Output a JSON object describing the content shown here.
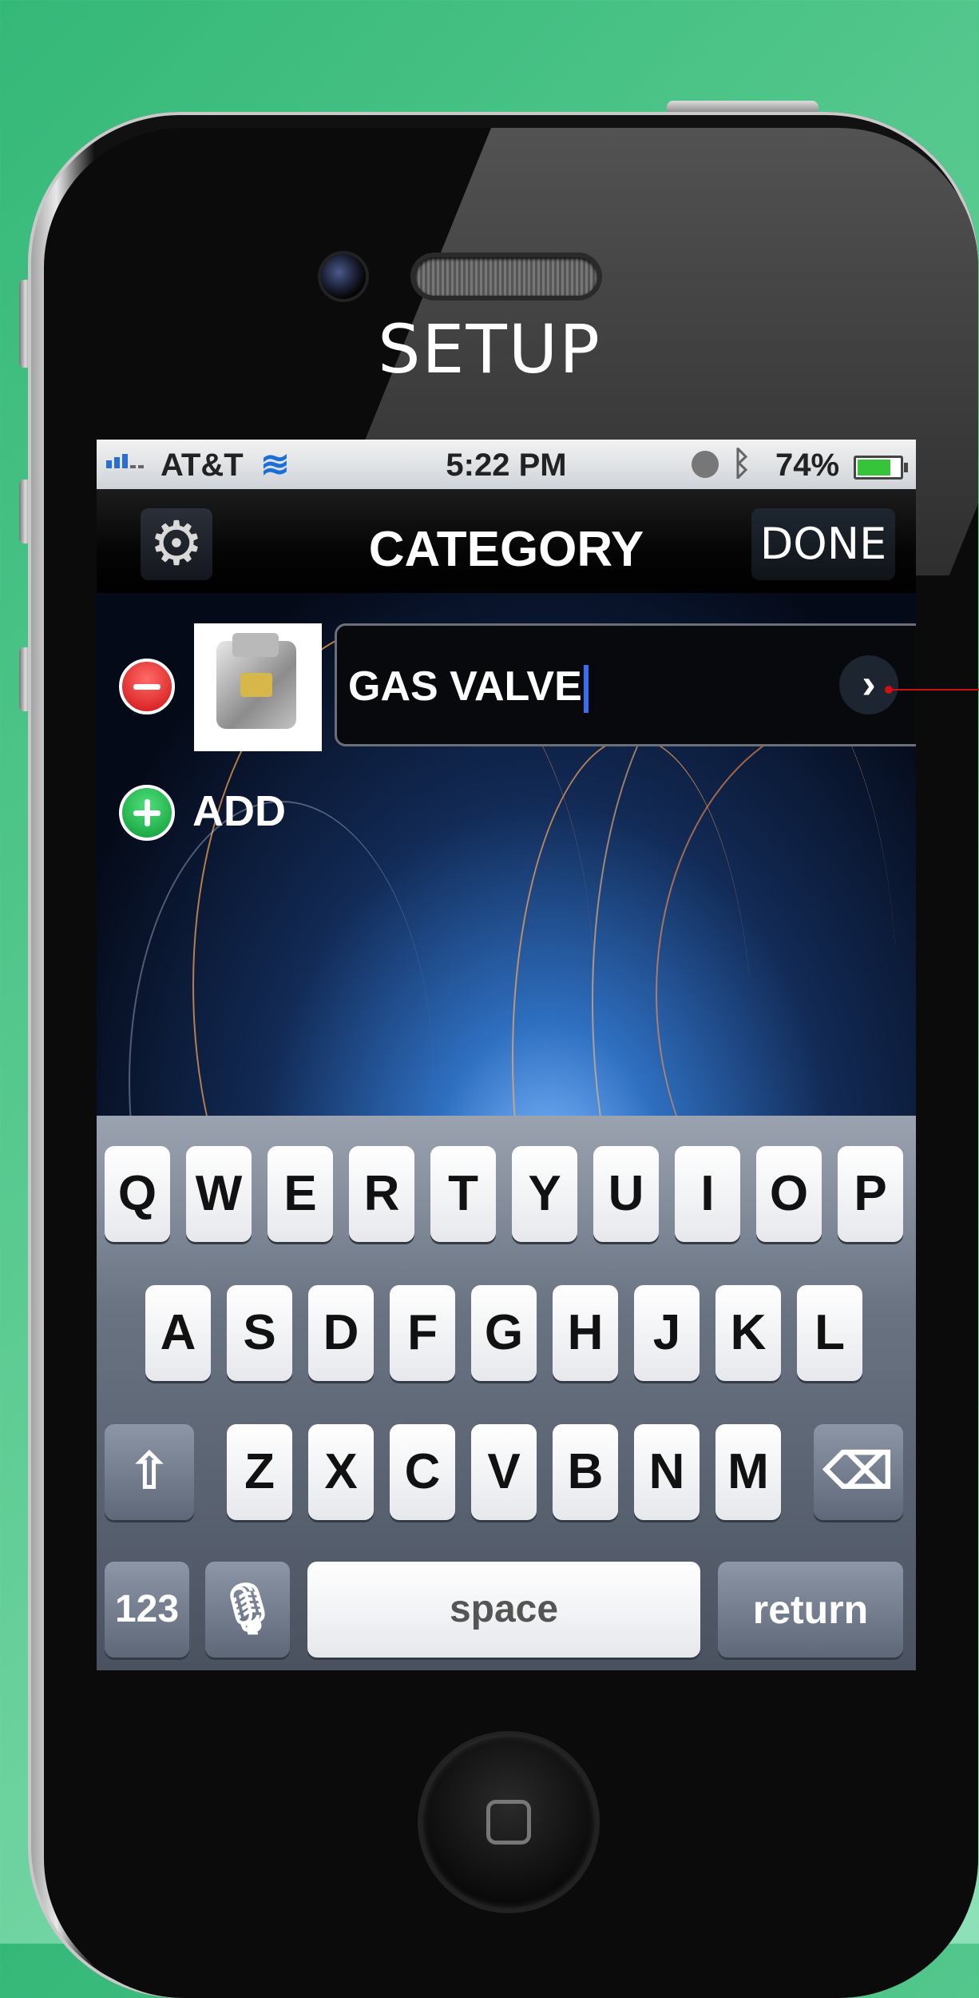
{
  "page_title": "SETUP",
  "status_bar": {
    "carrier": "AT&T",
    "time": "5:22 PM",
    "battery_percent": "74%"
  },
  "nav": {
    "title": "CATEGORY",
    "done_label": "DONE",
    "settings_icon": "gear-icon"
  },
  "category_item": {
    "name_value": "GAS VALVE",
    "remove_icon": "minus-circle-icon",
    "detail_icon": "chevron-right-icon"
  },
  "add": {
    "label": "ADD",
    "icon": "plus-circle-icon"
  },
  "keyboard": {
    "row1": [
      "Q",
      "W",
      "E",
      "R",
      "T",
      "Y",
      "U",
      "I",
      "O",
      "P"
    ],
    "row2": [
      "A",
      "S",
      "D",
      "F",
      "G",
      "H",
      "J",
      "K",
      "L"
    ],
    "row3": [
      "Z",
      "X",
      "C",
      "V",
      "B",
      "N",
      "M"
    ],
    "numbers_label": "123",
    "space_label": "space",
    "return_label": "return"
  },
  "colors": {
    "background": "#4cc386",
    "remove": "#d01010",
    "add": "#0e9a37",
    "caret": "#3a6df0"
  }
}
